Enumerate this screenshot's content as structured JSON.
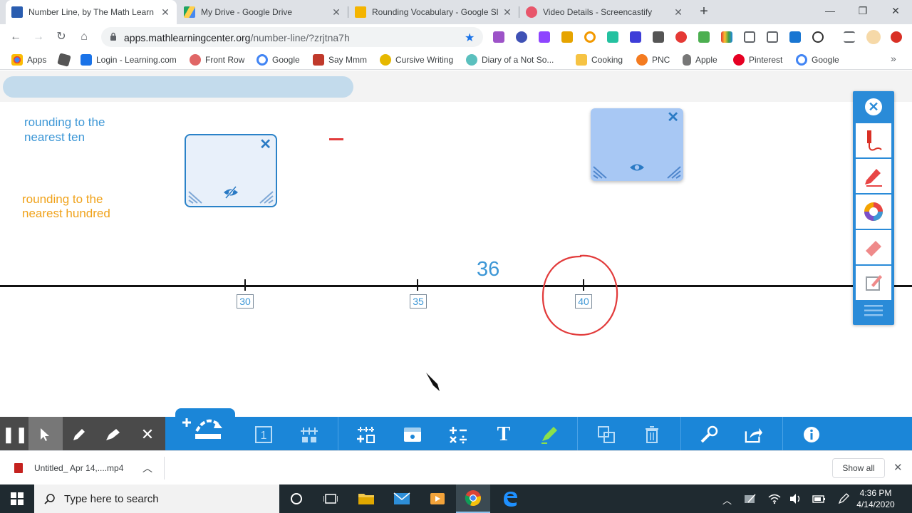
{
  "browser": {
    "tabs": [
      {
        "title": "Number Line, by The Math Learn",
        "active": true,
        "favicon_color": "#2a5db0"
      },
      {
        "title": "My Drive - Google Drive",
        "active": false,
        "favicon_color": "#1fa463"
      },
      {
        "title": "Rounding Vocabulary - Google Sl",
        "active": false,
        "favicon_color": "#f4b400"
      },
      {
        "title": "Video Details - Screencastify",
        "active": false,
        "favicon_color": "#e8566b"
      }
    ],
    "url_host": "apps.mathlearningcenter.org",
    "url_path": "/number-line/?zrjtna7h",
    "bookmarks": [
      {
        "label": "Apps",
        "color": "#4285f4"
      },
      {
        "label": "",
        "color": "#555555"
      },
      {
        "label": "Login - Learning.com",
        "color": "#1a73e8"
      },
      {
        "label": "Front Row",
        "color": "#e06666"
      },
      {
        "label": "Google",
        "color": "#4285f4"
      },
      {
        "label": "Say Mmm",
        "color": "#c0392b"
      },
      {
        "label": "Cursive Writing",
        "color": "#e6b800"
      },
      {
        "label": "Diary of a Not So...",
        "color": "#5bc0be"
      },
      {
        "label": "Cooking",
        "color": "#f6c343"
      },
      {
        "label": "PNC",
        "color": "#f47b20"
      },
      {
        "label": "Apple",
        "color": "#777777"
      },
      {
        "label": "Pinterest",
        "color": "#e60023"
      },
      {
        "label": "Google",
        "color": "#4285f4"
      }
    ]
  },
  "app": {
    "label_ten": "rounding to the nearest ten",
    "label_hundred": "rounding to the nearest hundred",
    "jump_value": "36",
    "ticks": [
      "30",
      "35",
      "40"
    ],
    "colors": {
      "accent": "#3d97d6",
      "orange": "#f0a21a",
      "red": "#e23b3b",
      "toolbar": "#1b86d8"
    }
  },
  "sidepanel": {
    "close_icon": "close-icon",
    "tools": [
      "pen-draw-icon",
      "marker-icon",
      "color-wheel-icon",
      "eraser-icon",
      "clear-icon"
    ]
  },
  "bottombar": {
    "text_tool": "T",
    "box_label": "1"
  },
  "downloads": {
    "file": "Untitled_ Apr 14,....mp4",
    "show_all": "Show all"
  },
  "taskbar": {
    "search_placeholder": "Type here to search",
    "time": "4:36 PM",
    "date": "4/14/2020"
  }
}
